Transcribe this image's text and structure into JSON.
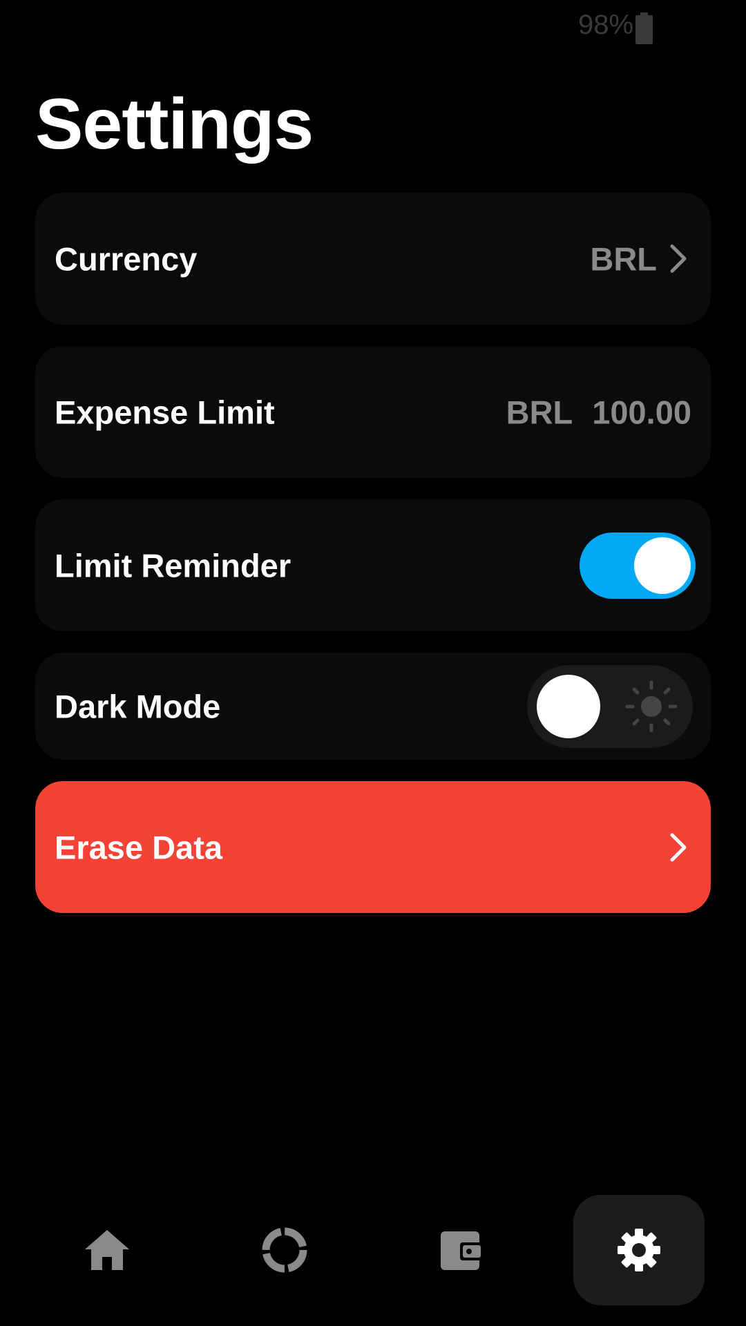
{
  "status_bar": {
    "battery_percent": "98%",
    "battery_icon": "battery-full-icon"
  },
  "page": {
    "title": "Settings"
  },
  "settings": {
    "currency": {
      "label": "Currency",
      "value": "BRL",
      "icon": "chevron-right-icon"
    },
    "expense_limit": {
      "label": "Expense Limit",
      "currency": "BRL",
      "amount": "100.00"
    },
    "limit_reminder": {
      "label": "Limit Reminder",
      "enabled": true
    },
    "dark_mode": {
      "label": "Dark Mode",
      "enabled": true,
      "icon": "sun-icon"
    },
    "erase_data": {
      "label": "Erase Data",
      "icon": "chevron-right-icon"
    }
  },
  "bottom_nav": {
    "items": [
      {
        "icon": "home-icon",
        "active": false
      },
      {
        "icon": "chart-ring-icon",
        "active": false
      },
      {
        "icon": "wallet-icon",
        "active": false
      },
      {
        "icon": "gear-icon",
        "active": true
      }
    ]
  },
  "colors": {
    "background": "#000000",
    "card": "#0b0b0c",
    "accent": "#03a9f4",
    "danger": "#f44336",
    "muted_text": "#8a8a8a"
  }
}
